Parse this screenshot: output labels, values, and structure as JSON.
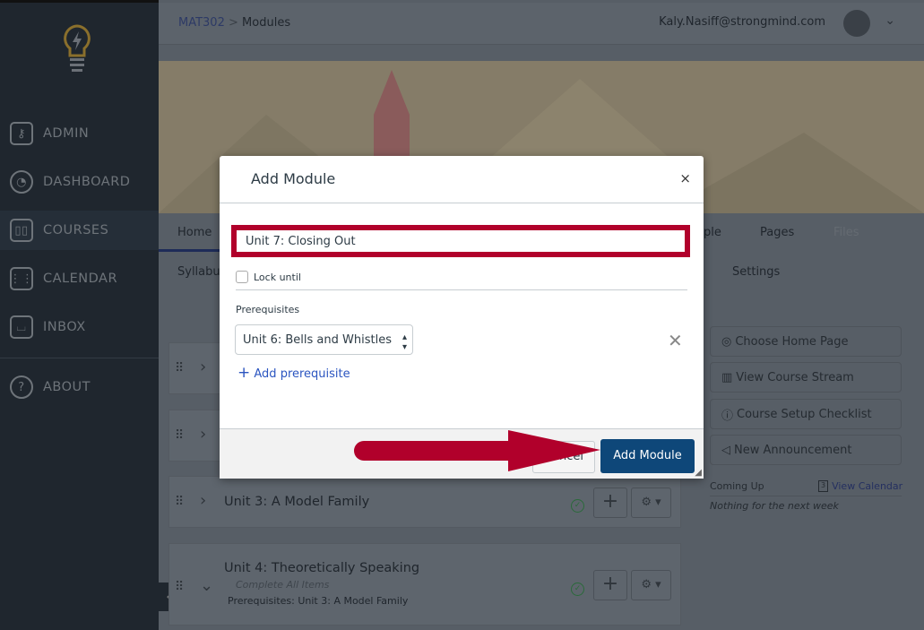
{
  "sidebar": {
    "items": [
      {
        "label": "ADMIN",
        "icon": "shield-key-icon"
      },
      {
        "label": "DASHBOARD",
        "icon": "speedometer-icon"
      },
      {
        "label": "COURSES",
        "icon": "book-icon"
      },
      {
        "label": "CALENDAR",
        "icon": "calendar-icon"
      },
      {
        "label": "INBOX",
        "icon": "inbox-icon"
      },
      {
        "label": "ABOUT",
        "icon": "question-icon"
      }
    ],
    "active": "COURSES"
  },
  "header": {
    "course": "MAT302",
    "separator": ">",
    "page": "Modules",
    "user": "Kaly.Nasiff@strongmind.com"
  },
  "tabs": [
    "Home",
    "Syllabu",
    "ple",
    "Pages",
    "Files",
    "Settings"
  ],
  "modules": [
    {
      "title": ""
    },
    {
      "title": ""
    },
    {
      "title": "Unit 3: A Model Family"
    },
    {
      "title": "Unit 4: Theoretically Speaking",
      "requirement": "Complete All Items",
      "prerequisites": "Prerequisites: Unit 3: A Model Family"
    }
  ],
  "right": {
    "buttons": [
      "Choose Home Page",
      "View Course Stream",
      "Course Setup Checklist",
      "New Announcement"
    ],
    "coming_up": "Coming Up",
    "view_calendar": "View Calendar",
    "calendar_day": "3",
    "nothing": "Nothing for the next week"
  },
  "modal": {
    "title": "Add Module",
    "close": "×",
    "name_value": "Unit 7: Closing Out",
    "lock_label": "Lock until",
    "prereq_label": "Prerequisites",
    "prereq_selected": "Unit 6: Bells and Whistles",
    "add_prereq": "Add prerequisite",
    "cancel": "Cancel",
    "submit": "Add Module"
  },
  "colors": {
    "highlight": "#b1002b",
    "primary": "#0e4779",
    "link": "#2b55c0"
  }
}
